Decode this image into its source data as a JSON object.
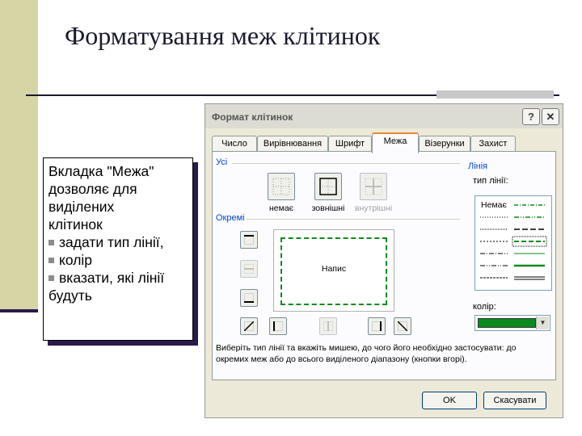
{
  "slide": {
    "title": "Форматування меж клітинок",
    "note": {
      "line1": "Вкладка \"Межа\"",
      "line2": "дозволяє для",
      "line3": "виділених",
      "line4": "клітинок",
      "bullet1": "задати тип лінії,",
      "bullet2": "колір",
      "bullet3": "вказати, які лінії",
      "line5": "будуть"
    }
  },
  "dialog": {
    "title": "Формат клітинок",
    "help_label": "?",
    "close_label": "✕",
    "tabs": [
      {
        "label": "Число"
      },
      {
        "label": "Вирівнювання"
      },
      {
        "label": "Шрифт"
      },
      {
        "label": "Межа"
      },
      {
        "label": "Візерунки"
      },
      {
        "label": "Захист"
      }
    ],
    "presets_group": "Усі",
    "presets": [
      {
        "label": "немає"
      },
      {
        "label": "зовнішні"
      },
      {
        "label": "внутрішні"
      }
    ],
    "border_group": "Окремі",
    "preview_text": "Напис",
    "line_group": "Лінія",
    "line_type_label": "тип лінії:",
    "line_none_label": "Немає",
    "color_label": "колір:",
    "line_color": "#0b8a1e",
    "hint": "Виберіть тип лінії та вкажіть мишею, до чого його необхідно застосувати: до окремих меж або до всього виділеного діапазону (кнопки вгорі).",
    "ok_label": "OK",
    "cancel_label": "Скасувати"
  }
}
